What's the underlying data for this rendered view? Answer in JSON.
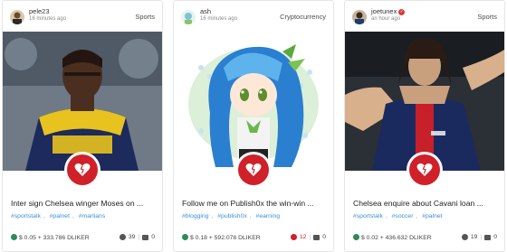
{
  "cards": [
    {
      "author": "pele23",
      "time": "16 minutes ago",
      "category": "Sports",
      "title": "Inter sign Chelsea winger Moses on ...",
      "tags": [
        "#sportstalk",
        "#palnet",
        "#marlians"
      ],
      "price": "$ 0.05 + 333.786 DLIKER",
      "upvotes": "39",
      "comments": "0",
      "verified": false
    },
    {
      "author": "ash",
      "time": "16 minutes ago",
      "category": "Cryptocurrency",
      "title": "Follow me on Publish0x the win-win ...",
      "tags": [
        "#blogging",
        "#publish0x",
        "#earning"
      ],
      "price": "$ 0.18 + 592.078 DLIKER",
      "upvotes": "12",
      "comments": "0",
      "verified": false
    },
    {
      "author": "joetunex",
      "time": "an hour ago",
      "category": "Sports",
      "title": "Chelsea enquire about Cavani loan ...",
      "tags": [
        "#sportstalk",
        "#soccer",
        "#palnet"
      ],
      "price": "$ 0.02 + 436.632 DLIKER",
      "upvotes": "19",
      "comments": "0",
      "verified": true
    }
  ],
  "icons": {
    "like": "heart-icon",
    "upvote": "upvote-icon",
    "comment": "comment-icon",
    "coin": "coin-icon",
    "verified": "verified-badge-icon"
  },
  "colors": {
    "accent": "#d0202a",
    "tag": "#3a8fd6",
    "coin": "#2e8b57"
  }
}
